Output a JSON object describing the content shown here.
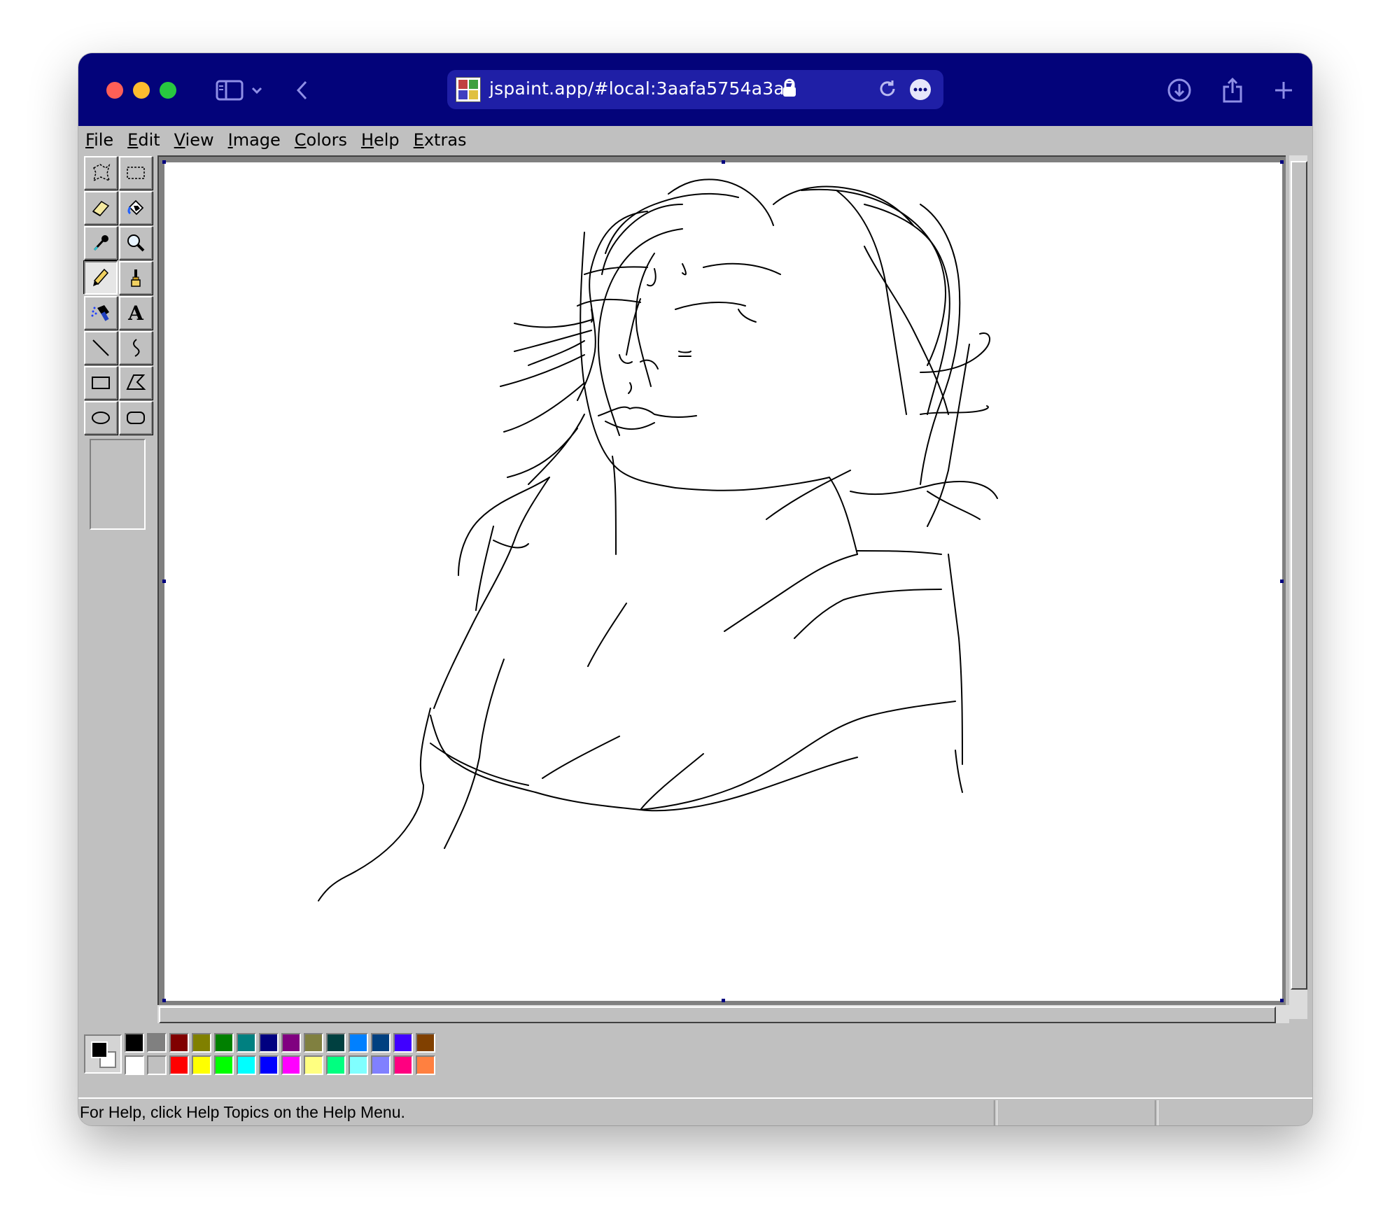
{
  "browser": {
    "url": "jspaint.app/#local:3aafa5754a3a7",
    "toolbar_color": "#03037a",
    "icons": [
      "sidebar-icon",
      "chevron-down-icon",
      "back-icon",
      "lock-icon",
      "reload-icon",
      "more-icon",
      "download-icon",
      "share-icon",
      "new-tab-icon"
    ]
  },
  "menu": {
    "items": [
      {
        "label": "File"
      },
      {
        "label": "Edit"
      },
      {
        "label": "View"
      },
      {
        "label": "Image"
      },
      {
        "label": "Colors"
      },
      {
        "label": "Help"
      },
      {
        "label": "Extras"
      }
    ]
  },
  "toolbox": {
    "tools": [
      {
        "id": "free-form-select",
        "icon": "free-form-select-icon"
      },
      {
        "id": "select",
        "icon": "rectangle-select-icon"
      },
      {
        "id": "eraser",
        "icon": "eraser-icon"
      },
      {
        "id": "fill",
        "icon": "fill-bucket-icon"
      },
      {
        "id": "pick-color",
        "icon": "eyedropper-icon"
      },
      {
        "id": "magnifier",
        "icon": "magnifier-icon"
      },
      {
        "id": "pencil",
        "icon": "pencil-icon",
        "active": true
      },
      {
        "id": "brush",
        "icon": "brush-icon"
      },
      {
        "id": "airbrush",
        "icon": "airbrush-icon"
      },
      {
        "id": "text",
        "icon": "text-icon",
        "glyph": "A"
      },
      {
        "id": "line",
        "icon": "line-icon"
      },
      {
        "id": "curve",
        "icon": "curve-icon"
      },
      {
        "id": "rectangle",
        "icon": "rectangle-icon"
      },
      {
        "id": "polygon",
        "icon": "polygon-icon"
      },
      {
        "id": "ellipse",
        "icon": "ellipse-icon"
      },
      {
        "id": "rounded-rectangle",
        "icon": "rounded-rectangle-icon"
      }
    ],
    "active_tool": "pencil"
  },
  "colors": {
    "foreground": "#000000",
    "background": "#ffffff",
    "palette_top": [
      "#000000",
      "#808080",
      "#800000",
      "#808000",
      "#008000",
      "#008080",
      "#000080",
      "#800080",
      "#808040",
      "#004040",
      "#0080ff",
      "#004080",
      "#4000ff",
      "#804000"
    ],
    "palette_bottom": [
      "#ffffff",
      "#c0c0c0",
      "#ff0000",
      "#ffff00",
      "#00ff00",
      "#00ffff",
      "#0000ff",
      "#ff00ff",
      "#ffff80",
      "#00ff80",
      "#80ffff",
      "#8080ff",
      "#ff0080",
      "#ff8040"
    ]
  },
  "status": {
    "help_text": "For Help, click Help Topics on the Help Menu."
  }
}
